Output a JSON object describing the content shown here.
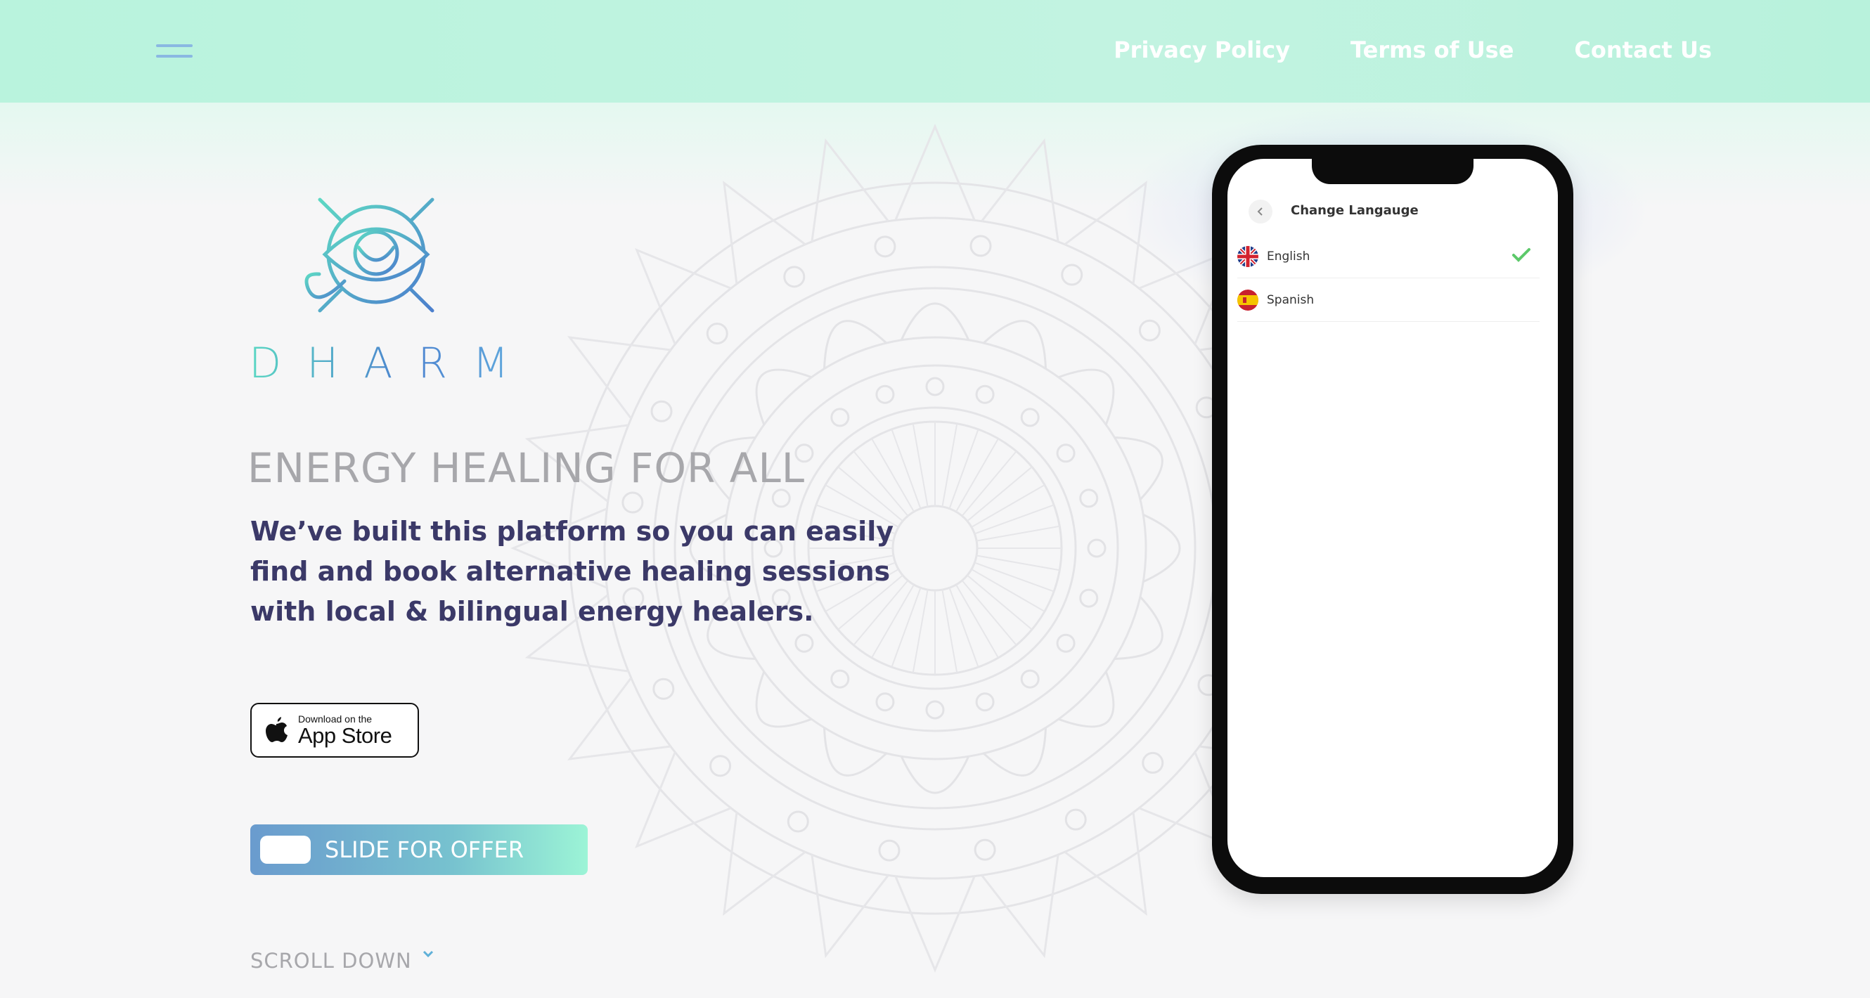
{
  "header": {
    "menu_icon": "hamburger-icon",
    "nav": [
      {
        "label": "Privacy Policy"
      },
      {
        "label": "Terms of Use"
      },
      {
        "label": "Contact Us"
      }
    ]
  },
  "brand": {
    "name": "DHARMA",
    "logo_icon": "eye-sun-icon"
  },
  "hero": {
    "tagline": "ENERGY HEALING FOR ALL",
    "description": "We’ve built this platform so you can easily find and book alternative healing sessions with local & bilingual energy healers."
  },
  "appstore": {
    "small": "Download on the",
    "big": "App Store",
    "icon": "apple-icon"
  },
  "slide": {
    "label": "SLIDE FOR OFFER"
  },
  "scroll": {
    "label": "SCROLL DOWN",
    "icon": "chevron-down-icon"
  },
  "phone": {
    "screen_title": "Change Langauge",
    "languages": [
      {
        "name": "English",
        "flag": "uk-flag-icon",
        "selected": true
      },
      {
        "name": "Spanish",
        "flag": "spain-flag-icon",
        "selected": false
      }
    ]
  },
  "colors": {
    "header_bg": "#b9f3dd",
    "text_dark": "#3b3968",
    "text_muted": "#a7a7ab",
    "check_green": "#5cc96a"
  }
}
